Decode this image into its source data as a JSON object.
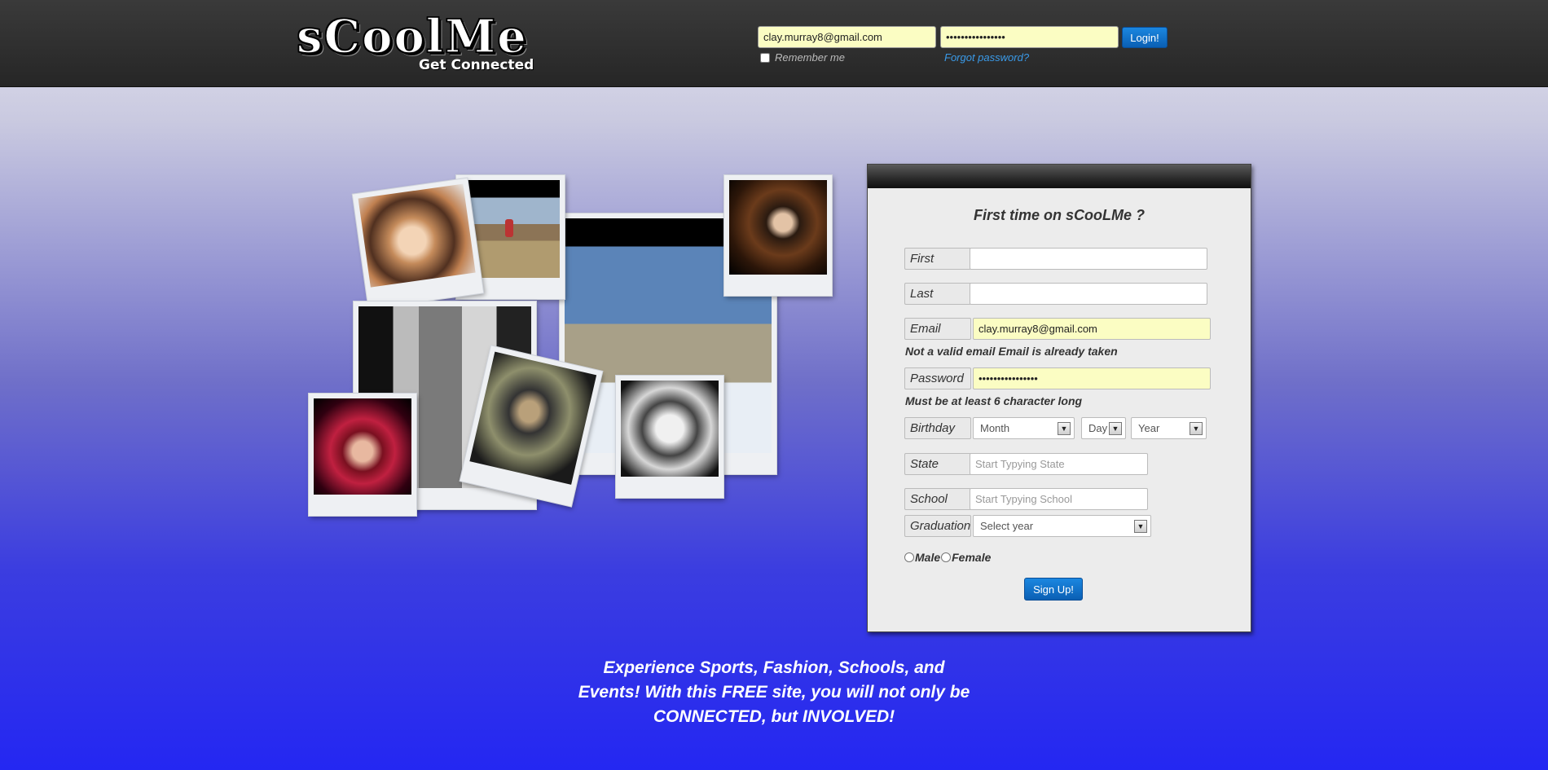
{
  "header": {
    "logo_text": "sCoolMe",
    "logo_tagline": "Get Connected",
    "email_value": "clay.murray8@gmail.com",
    "password_value": "••••••••••••••••",
    "login_label": "Login!",
    "remember_label": "Remember me",
    "forgot_label": "Forgot password?"
  },
  "signup": {
    "title": "First time on sCooLMe ?",
    "first_label": "First",
    "last_label": "Last",
    "email_label": "Email",
    "email_value": "clay.murray8@gmail.com",
    "email_error": "Not a valid email Email is already taken",
    "password_label": "Password",
    "password_value": "••••••••••••••••",
    "password_error": "Must be at least 6 character long",
    "birthday_label": "Birthday",
    "month_value": "Month",
    "day_value": "Day",
    "year_value": "Year",
    "state_label": "State",
    "state_placeholder": "Start Typying State",
    "school_label": "School",
    "school_placeholder": "Start Typying School",
    "graduation_label": "Graduation",
    "graduation_value": "Select year",
    "male_label": "Male",
    "female_label": "Female",
    "signup_label": "Sign Up!"
  },
  "tagline": {
    "line1": "Experience Sports, Fashion, Schools, and",
    "line2": "Events! With this FREE site, you will not only be",
    "line3": "CONNECTED, but INVOLVED!"
  },
  "icons": {
    "dropdown_arrow": "chevron-down-icon"
  },
  "colors": {
    "header_bg": "#2b2b2b",
    "autofill_yellow": "#fbfdc3",
    "button_blue": "#0a6fc9",
    "link_blue": "#3a9ae8"
  }
}
